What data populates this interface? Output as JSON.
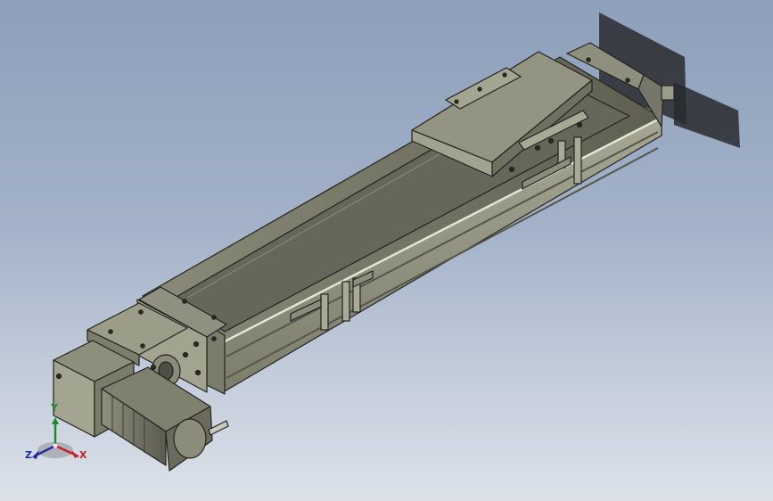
{
  "viewport": {
    "background_top": "#8d9fba",
    "background_bottom": "#dde2ea",
    "model": "linear-actuator-module"
  },
  "triad": {
    "x_label": "X",
    "y_label": "Y",
    "z_label": "Z",
    "x_color": "#c8202a",
    "y_color": "#1d8a2a",
    "z_color": "#1f2f9c"
  },
  "colors": {
    "body": "#9a9b87",
    "body_top": "#6f705f",
    "body_dark": "#4f5047",
    "edge": "#22231f",
    "sensor_shadow": "#2b2b30"
  }
}
